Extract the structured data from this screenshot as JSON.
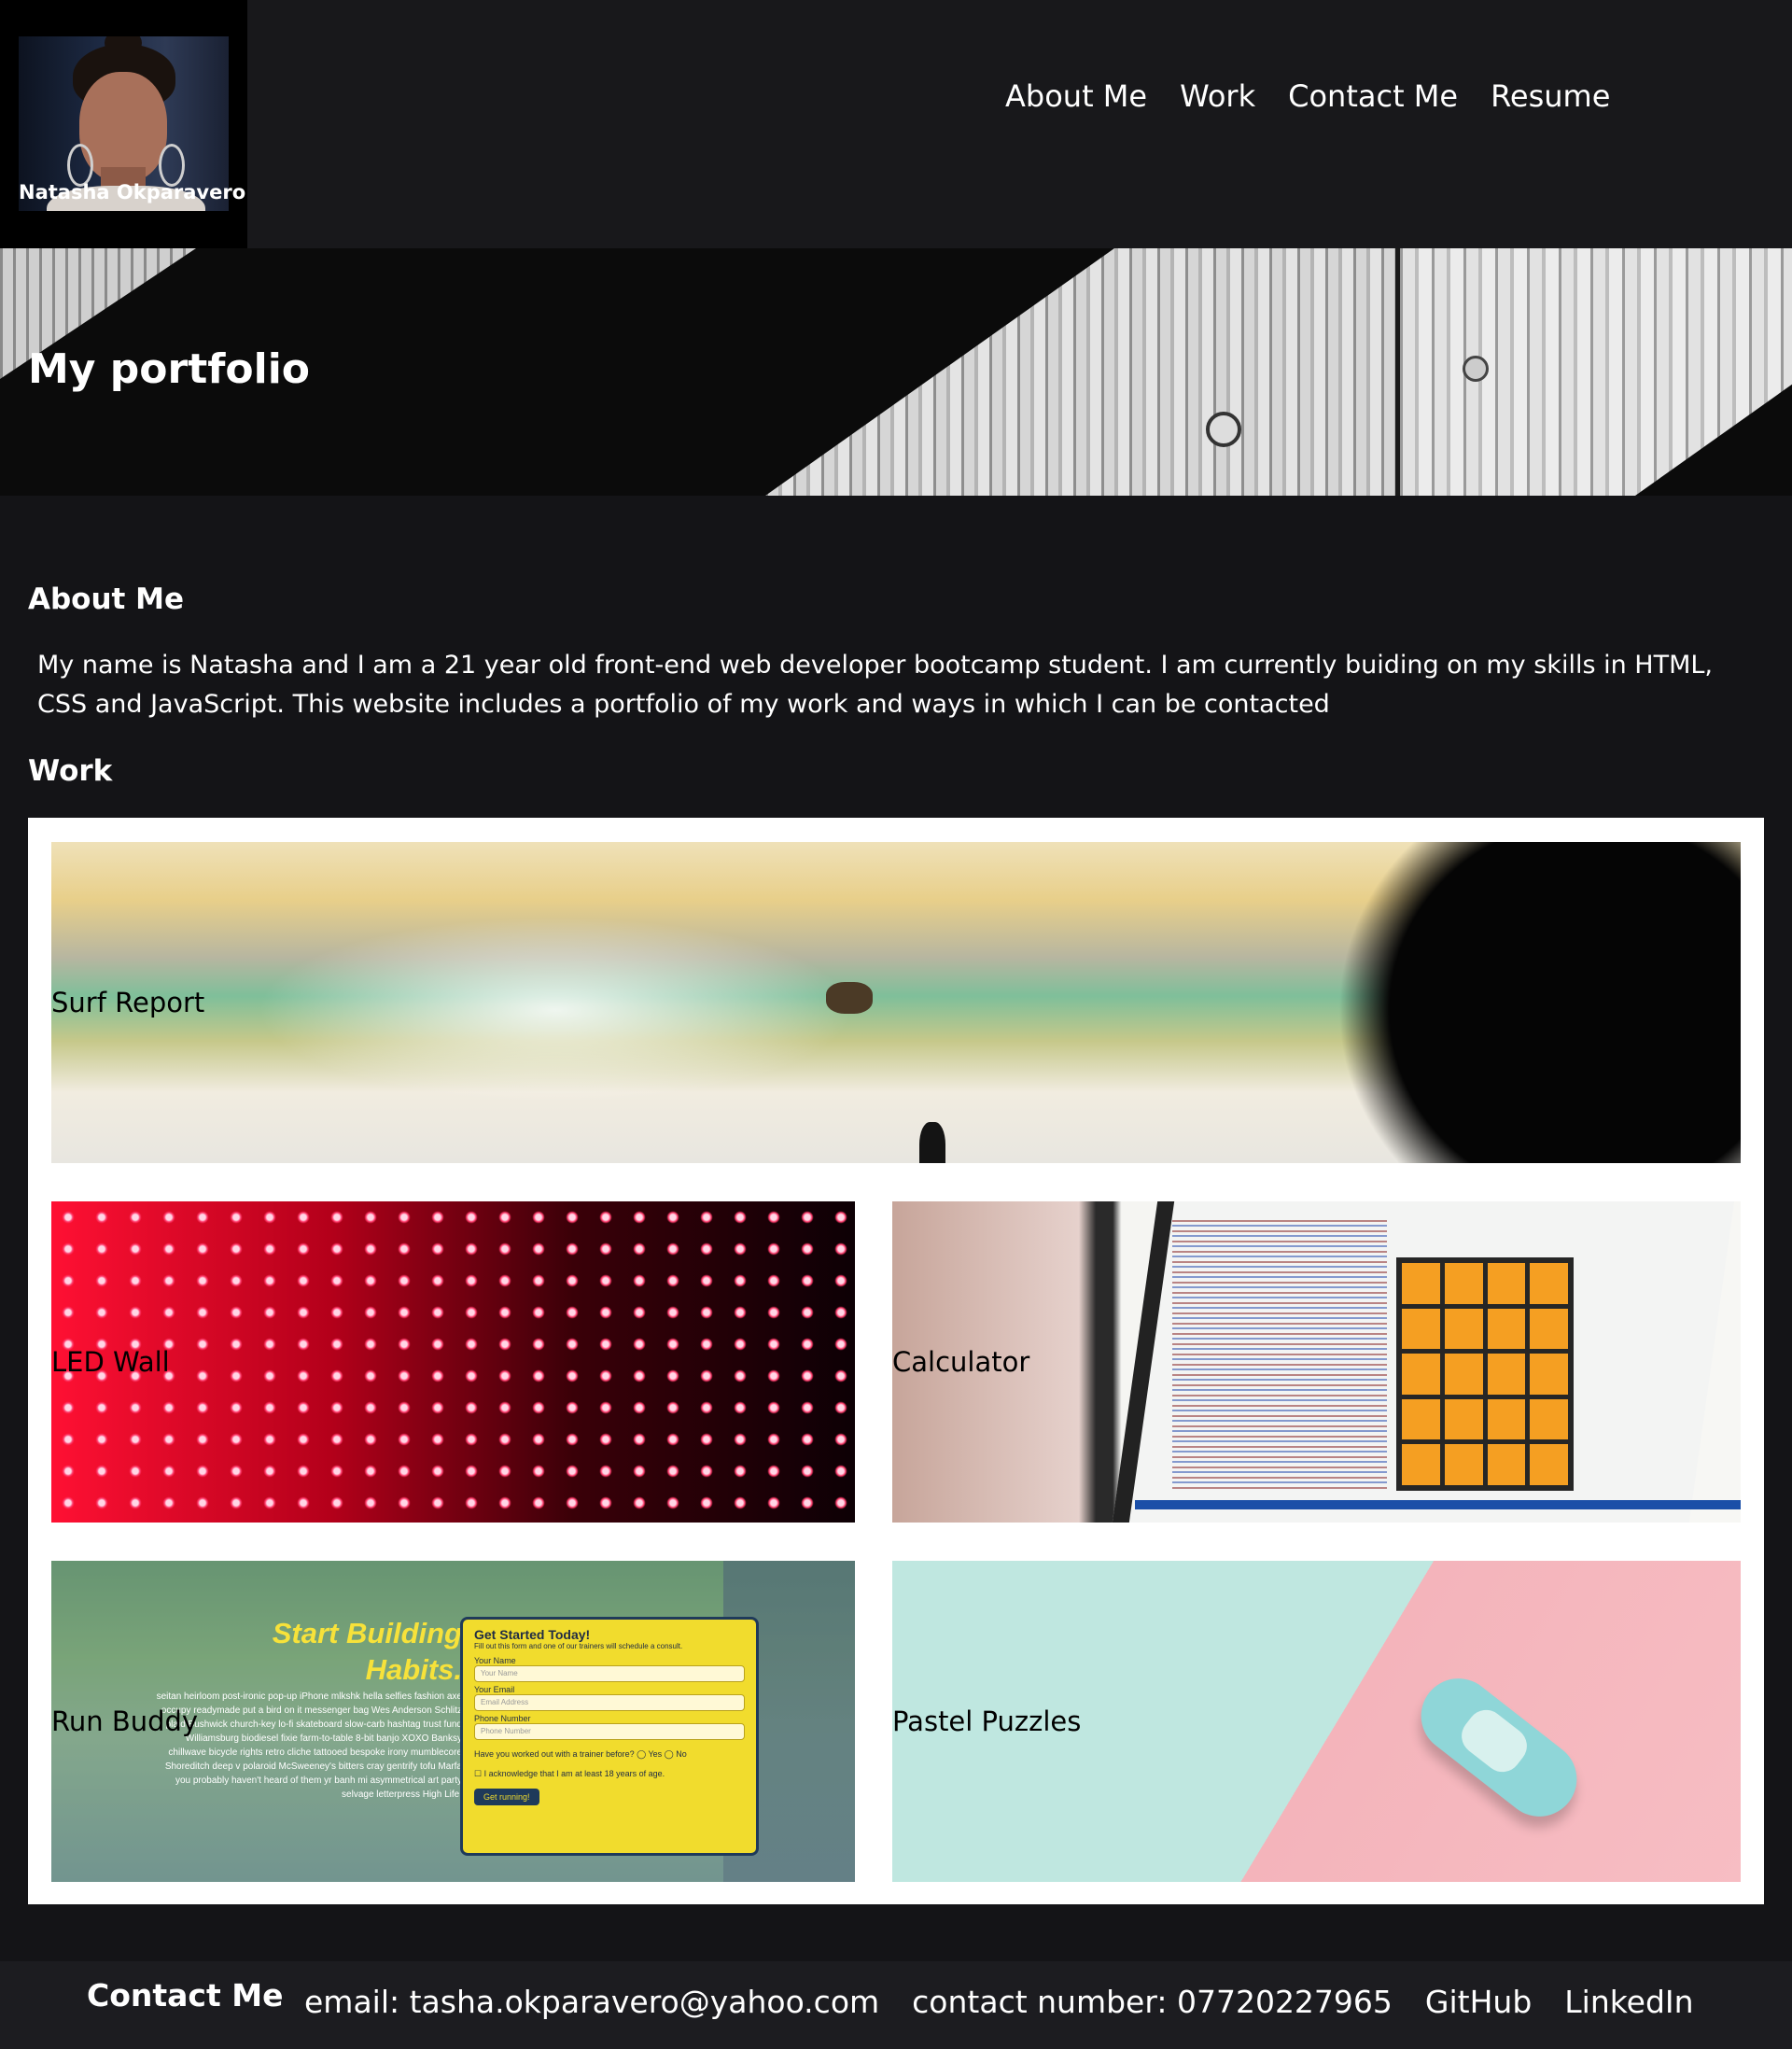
{
  "header": {
    "name": "Natasha Okparavero",
    "nav": [
      "About Me",
      "Work",
      "Contact Me",
      "Resume"
    ]
  },
  "hero": {
    "title": "My portfolio"
  },
  "about": {
    "heading": "About Me",
    "text": "My name is Natasha and I am a 21 year old front-end web developer bootcamp student. I am currently buiding on my skills in HTML, CSS and JavaScript. This website includes a portfolio of my work and ways in which I can be contacted"
  },
  "work": {
    "heading": "Work",
    "projects": [
      "Surf Report",
      "LED Wall",
      "Calculator",
      "Run Buddy",
      "Pastel Puzzles"
    ],
    "run_buddy_preview": {
      "headline": "Start Building Habits.",
      "blurb": "seitan heirloom post-ironic pop-up iPhone mlkshk hella selfies fashion axe occupy readymade put a bird on it messenger bag Wes Anderson Schlitz plaid Bushwick church-key lo-fi skateboard slow-carb hashtag trust fund Williamsburg biodiesel fixie farm-to-table 8-bit banjo XOXO Banksy chillwave bicycle rights retro cliche tattooed bespoke irony mumblecore Shoreditch deep v polaroid McSweeney's bitters cray gentrify tofu Marfa you probably haven't heard of them yr banh mi asymmetrical art party selvage letterpress High Life.",
      "form_title": "Get Started Today!",
      "form_subtitle": "Fill out this form and one of our trainers will schedule a consult.",
      "name_label": "Your Name",
      "name_placeholder": "Your Name",
      "email_label": "Your Email",
      "email_placeholder": "Email Address",
      "phone_label": "Phone Number",
      "phone_placeholder": "Phone Number",
      "question": "Have you worked out with a trainer before?  ◯ Yes  ◯ No",
      "ack": "☐ I acknowledge that I am at least 18 years of age.",
      "button": "Get running!"
    }
  },
  "footer": {
    "title": "Contact Me",
    "email": "email: tasha.okparavero@yahoo.com",
    "phone": "contact number: 07720227965",
    "github": "GitHub",
    "linkedin": "LinkedIn"
  }
}
